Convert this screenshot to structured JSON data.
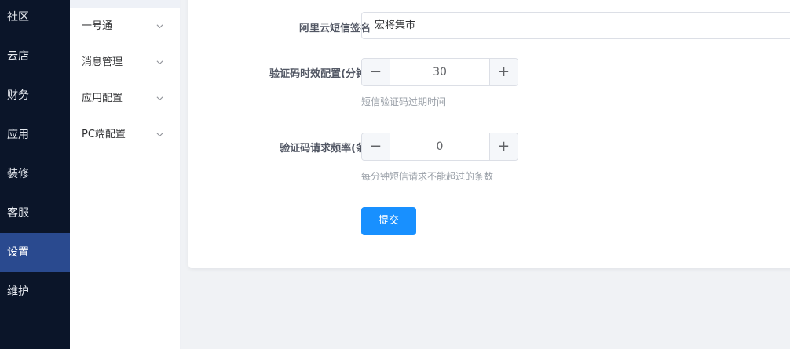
{
  "nav": {
    "items": [
      {
        "label": "社区",
        "active": false
      },
      {
        "label": "云店",
        "active": false
      },
      {
        "label": "财务",
        "active": false
      },
      {
        "label": "应用",
        "active": false
      },
      {
        "label": "装修",
        "active": false
      },
      {
        "label": "客服",
        "active": false
      },
      {
        "label": "设置",
        "active": true
      },
      {
        "label": "维护",
        "active": false
      }
    ]
  },
  "submenu": {
    "items": [
      {
        "label": "一号通",
        "icon": "chevron-down-icon"
      },
      {
        "label": "消息管理",
        "icon": "chevron-down-icon"
      },
      {
        "label": "应用配置",
        "icon": "chevron-down-icon"
      },
      {
        "label": "PC端配置",
        "icon": "chevron-down-icon"
      }
    ]
  },
  "form": {
    "signature": {
      "label": "阿里云短信签名",
      "value": "宏将集市"
    },
    "code_expiry": {
      "label": "验证码时效配置(分钟)",
      "value": "30",
      "hint": "短信验证码过期时间"
    },
    "request_rate": {
      "label": "验证码请求频率(条)",
      "value": "0",
      "hint": "每分钟短信请求不能超过的条数"
    },
    "submit_label": "提交"
  },
  "colors": {
    "nav_bg": "#0b1529",
    "nav_active": "#2a4a8f",
    "primary": "#1890ff"
  }
}
